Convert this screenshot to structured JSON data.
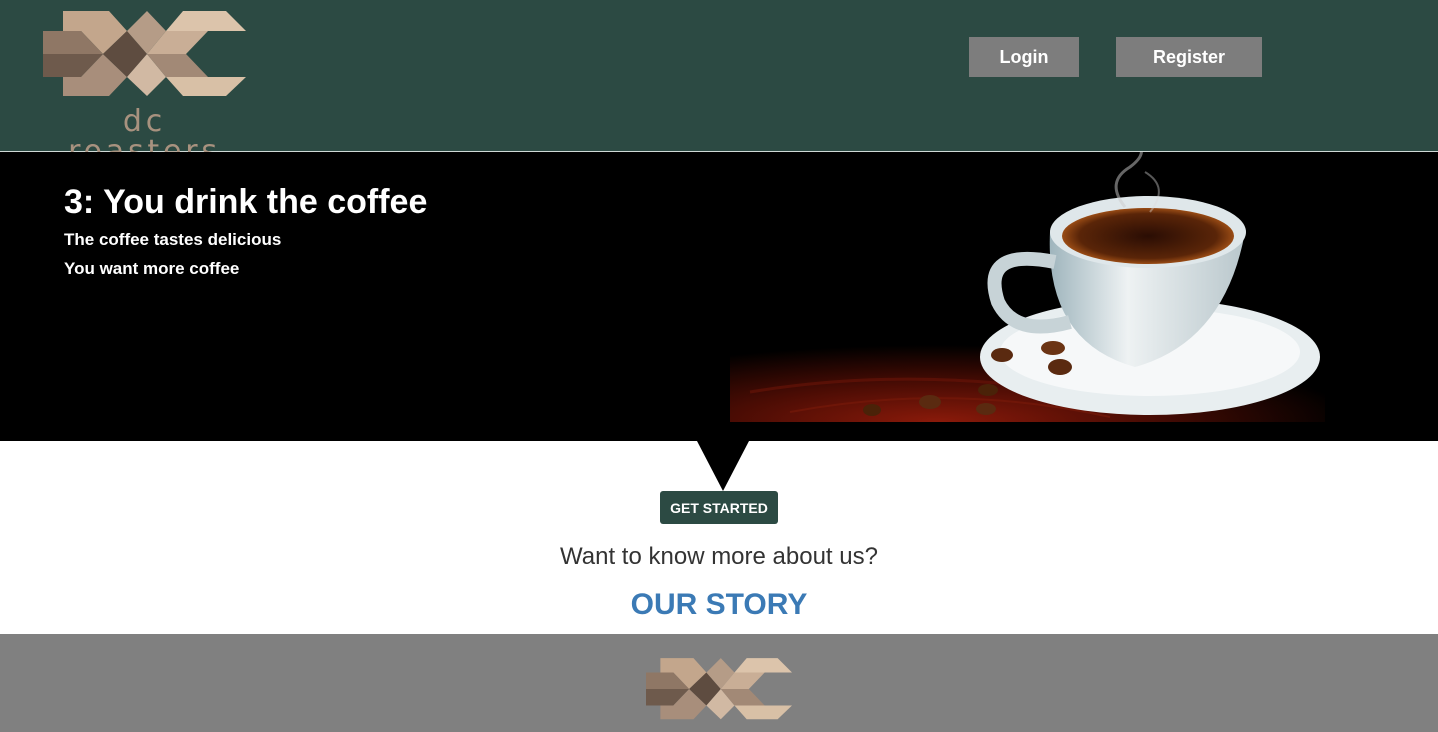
{
  "brand": {
    "name": "dc roasters"
  },
  "nav": {
    "login_label": "Login",
    "register_label": "Register"
  },
  "hero": {
    "title": "3: You drink the coffee",
    "line1": "The coffee tastes delicious",
    "line2": "You want more coffee",
    "image": "coffee-cup-image"
  },
  "cta": {
    "get_started_label": "GET STARTED"
  },
  "about": {
    "question": "Want to know more about us?",
    "link_label": "OUR STORY"
  },
  "colors": {
    "header_bg": "#2c4a43",
    "button_gray": "#7d7d7d",
    "link_blue": "#3b7ab5",
    "footer_bg": "#808080"
  }
}
